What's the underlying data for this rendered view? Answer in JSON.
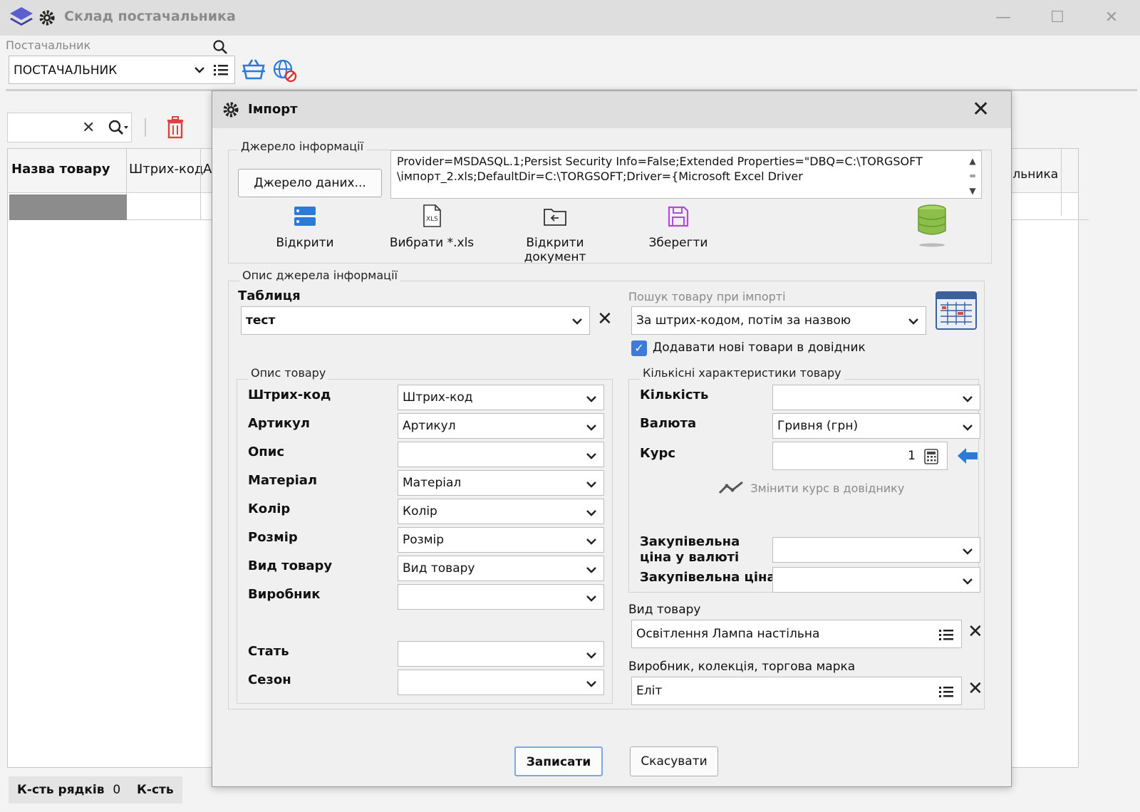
{
  "window": {
    "title": "Склад постачальника"
  },
  "supplier": {
    "label": "Постачальник",
    "value": "ПОСТАЧАЛЬНИК"
  },
  "grid": {
    "columns": [
      "Назва товару",
      "Штрих-код",
      "А",
      "альника"
    ]
  },
  "status": {
    "rows_label": "К-сть рядків",
    "rows_value": "0",
    "qty_label": "К-сть"
  },
  "dialog": {
    "title": "Імпорт",
    "source_group": "Джерело інформації",
    "source_button": "Джерело даних...",
    "connection_line1": "Provider=MSDASQL.1;Persist Security Info=False;Extended Properties=\"DBQ=C:\\TORGSOFT",
    "connection_line2": "\\імпорт_2.xls;DefaultDir=C:\\TORGSOFT;Driver={Microsoft Excel Driver",
    "tools": {
      "open": "Відкрити",
      "choose_xls": "Вибрати *.xls",
      "open_doc": "Відкрити документ",
      "save": "Зберегти"
    },
    "desc_group": "Опис джерела інформації",
    "table_label": "Таблиця",
    "table_value": "тест",
    "search_label": "Пошук товару при імпорті",
    "search_value": "За штрих-кодом, потім за назвою",
    "add_new_label": "Додавати нові товари в довідник",
    "product_group": "Опис товару",
    "product_fields": [
      {
        "label": "Штрих-код",
        "value": "Штрих-код"
      },
      {
        "label": "Артикул",
        "value": "Артикул"
      },
      {
        "label": "Опис",
        "value": ""
      },
      {
        "label": "Матеріал",
        "value": "Матеріал"
      },
      {
        "label": "Колір",
        "value": "Колір"
      },
      {
        "label": "Розмір",
        "value": "Розмір"
      },
      {
        "label": "Вид товару",
        "value": "Вид товару"
      },
      {
        "label": "Виробник",
        "value": ""
      },
      {
        "label": "Стать",
        "value": ""
      },
      {
        "label": "Сезон",
        "value": ""
      }
    ],
    "qty_group": "Кількісні характеристики товару",
    "qty_label": "Кількість",
    "qty_value": "",
    "currency_label": "Валюта",
    "currency_value": "Гривня (грн)",
    "rate_label": "Курс",
    "rate_value": "1",
    "change_rate_label": "Змінити курс в довіднику",
    "purchase_cur_label_1": "Закупівельна",
    "purchase_cur_label_2": "ціна у валюті",
    "purchase_cur_value": "",
    "purchase_label": "Закупівельна ціна",
    "purchase_value": "",
    "kind_label": "Вид товару",
    "kind_value": "Освітлення Лампа настільна",
    "maker_label": "Виробник, колекція, торгова марка",
    "maker_value": "Еліт",
    "ok_button": "Записати",
    "cancel_button": "Скасувати"
  },
  "colors": {
    "accent": "#3d7ad9",
    "trash": "#e04040",
    "save_icon": "#b04ad8",
    "db": "#8cbf4a"
  }
}
